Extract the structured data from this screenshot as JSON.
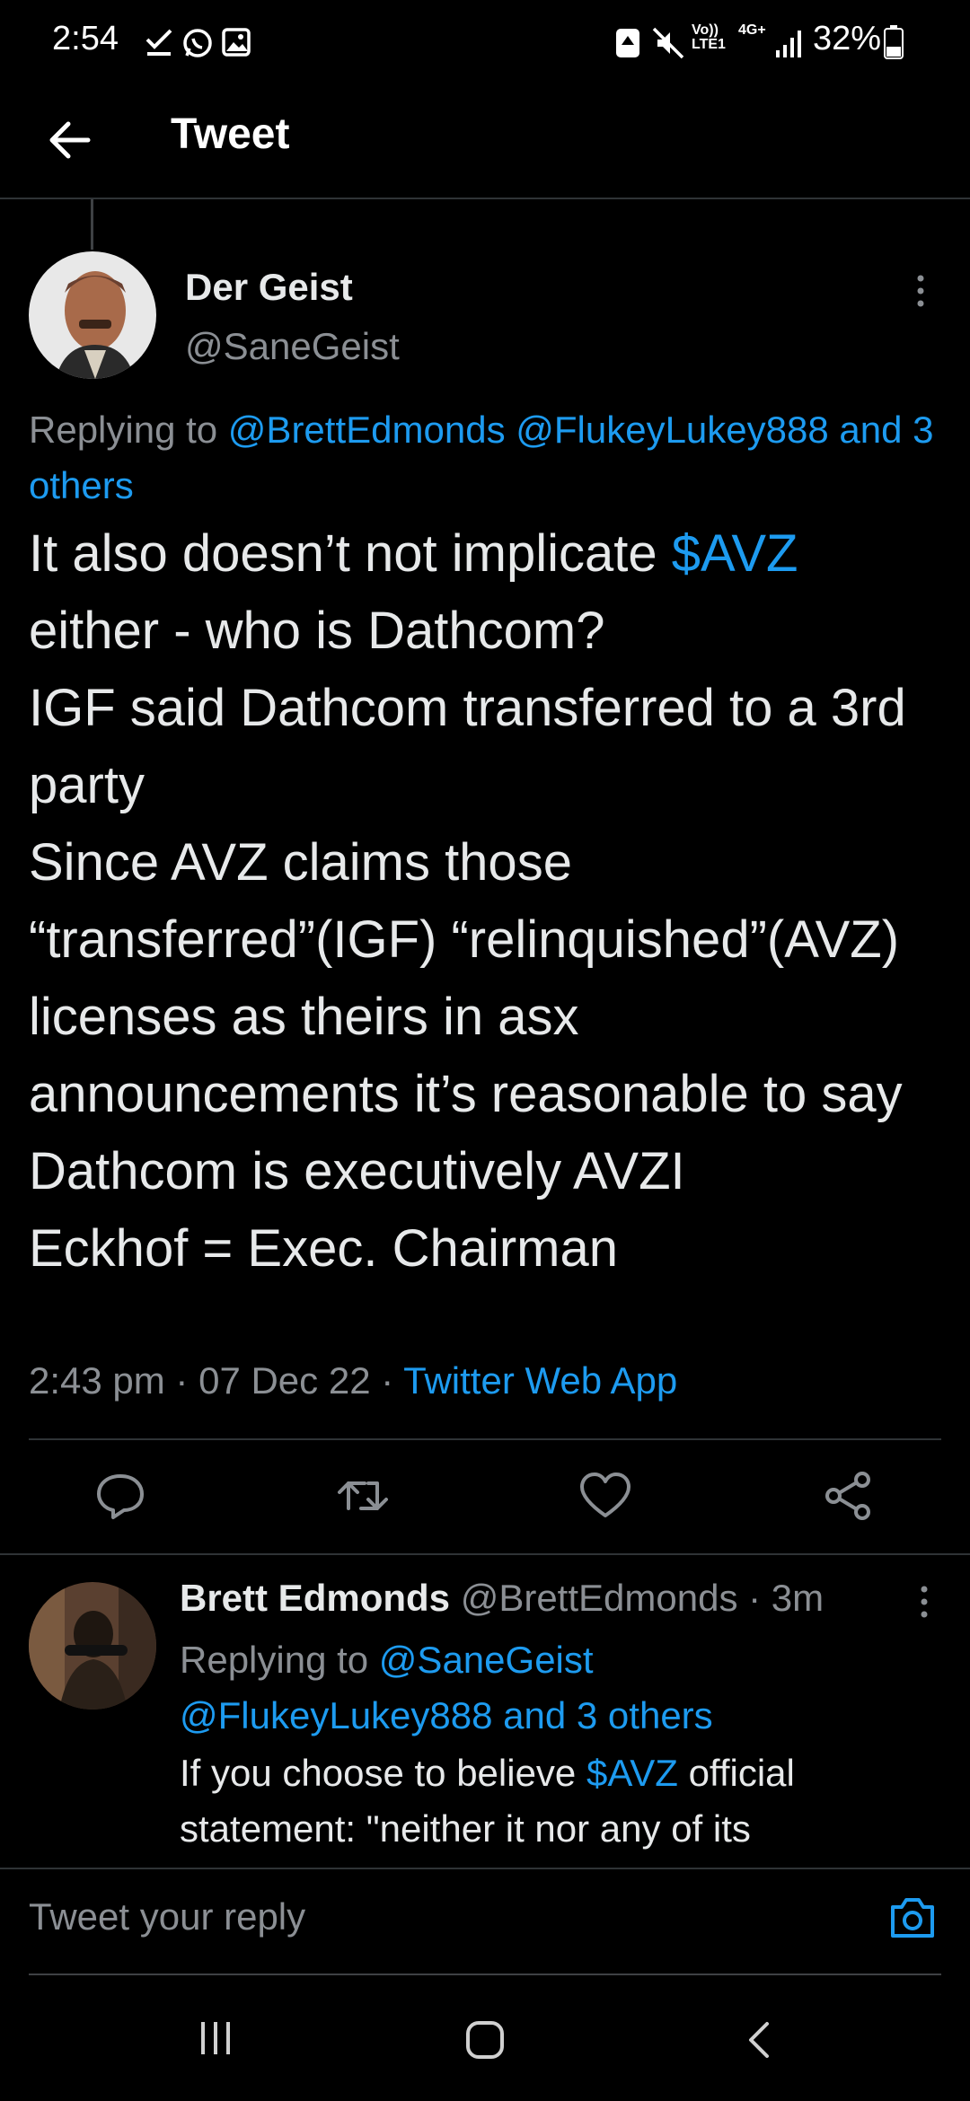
{
  "status_bar": {
    "time": "2:54",
    "battery": "32%",
    "network": "4G+",
    "volte": "Vo)) LTE1"
  },
  "header": {
    "title": "Tweet",
    "back_icon": "arrow-left-icon"
  },
  "main_tweet": {
    "name": "Der Geist",
    "handle": "@SaneGeist",
    "replying_prefix": "Replying to ",
    "replying_to_1": "@BrettEdmonds",
    "replying_to_2": "@FlukeyLukey888",
    "replying_others": "and 3 others",
    "body_part1": "It also doesn’t not implicate ",
    "cashtag": "$AVZ",
    "body_part2": "either - who is Dathcom?\nIGF said Dathcom transferred to a 3rd party\nSince AVZ claims those “transferred”(IGF) “relinquished”(AVZ) licenses as theirs in asx announcements it’s reasonable to say Dathcom is executively AVZI\nEckhof = Exec. Chairman",
    "time": "2:43 pm",
    "date": "07 Dec 22",
    "source": "Twitter Web App",
    "sep": " · "
  },
  "reply_tweet": {
    "name": "Brett Edmonds",
    "handle": "@BrettEdmonds",
    "age": "3m",
    "sep": " · ",
    "replying_prefix": "Replying to ",
    "replying_to_1": "@SaneGeist",
    "replying_to_2": "@FlukeyLukey888 and 3 others",
    "body_part1": "If you choose to believe ",
    "cashtag": "$AVZ",
    "body_part2": " official statement: \"neither it nor any of its"
  },
  "compose": {
    "placeholder": "Tweet your reply"
  },
  "colors": {
    "accent": "#1d9bf0",
    "background": "#000000",
    "text": "#e7e9ea",
    "muted": "#8b8f94",
    "divider": "#2f3336"
  },
  "icons": {
    "status": [
      "check-icon",
      "whatsapp-icon",
      "gallery-icon",
      "recycle-icon",
      "mute-icon",
      "signal-icon",
      "battery-icon"
    ],
    "actions": [
      "reply-icon",
      "retweet-icon",
      "like-icon",
      "share-icon"
    ],
    "compose": "camera-icon",
    "nav": [
      "recents-icon",
      "home-icon",
      "back-nav-icon"
    ]
  }
}
